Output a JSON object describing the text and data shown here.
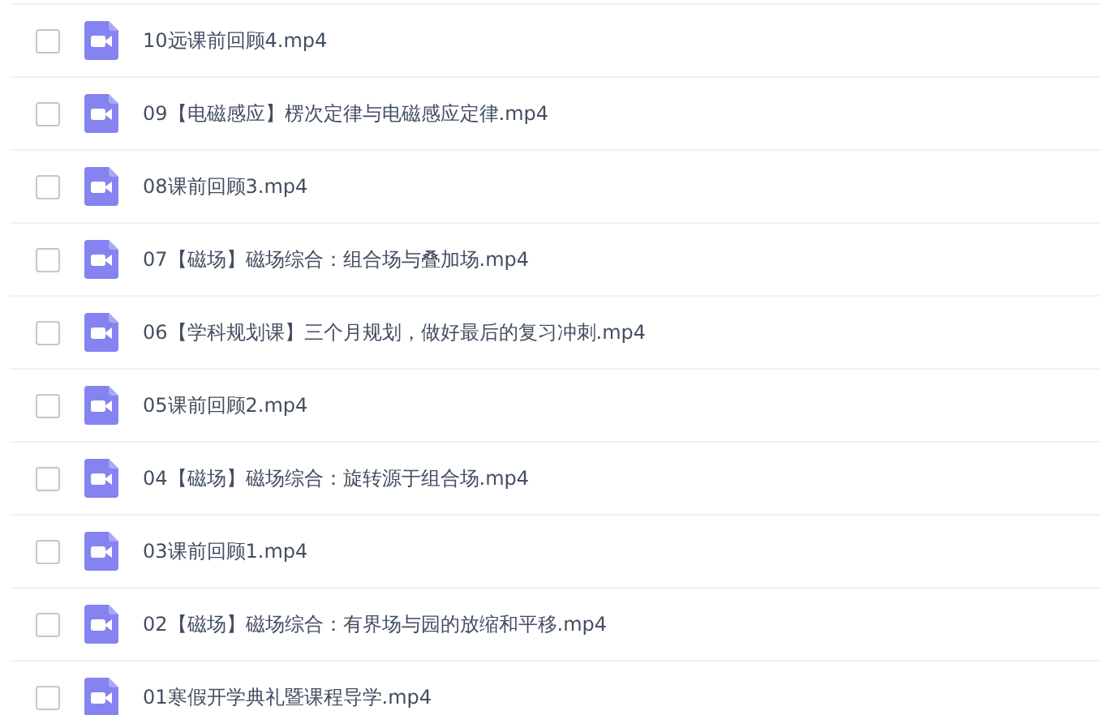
{
  "files": [
    {
      "name": "10远课前回顾4.mp4",
      "checked": false
    },
    {
      "name": "09【电磁感应】楞次定律与电磁感应定律.mp4",
      "checked": false
    },
    {
      "name": "08课前回顾3.mp4",
      "checked": false
    },
    {
      "name": "07【磁场】磁场综合：组合场与叠加场.mp4",
      "checked": false
    },
    {
      "name": "06【学科规划课】三个月规划，做好最后的复习冲刺.mp4",
      "checked": false
    },
    {
      "name": "05课前回顾2.mp4",
      "checked": false
    },
    {
      "name": "04【磁场】磁场综合：旋转源于组合场.mp4",
      "checked": false
    },
    {
      "name": "03课前回顾1.mp4",
      "checked": false
    },
    {
      "name": "02【磁场】磁场综合：有界场与园的放缩和平移.mp4",
      "checked": false
    },
    {
      "name": "01寒假开学典礼暨课程导学.mp4",
      "checked": false
    }
  ]
}
